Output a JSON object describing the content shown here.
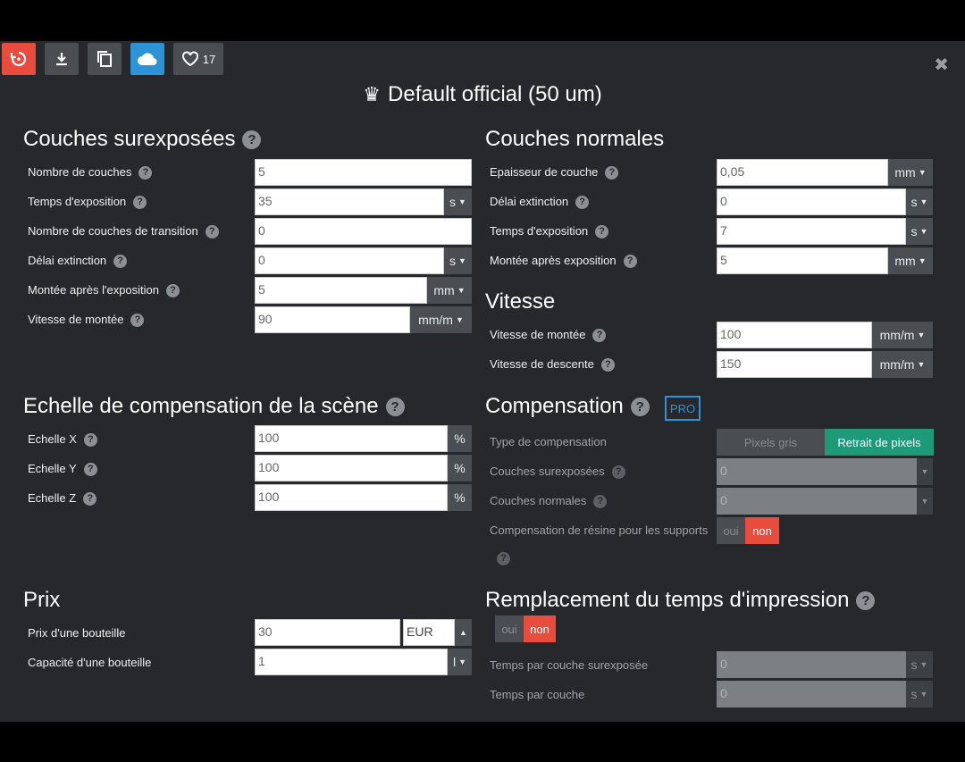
{
  "toolbar": {
    "likes": "17"
  },
  "title": "Default official (50 um)",
  "left": {
    "overexposed": {
      "heading": "Couches surexposées",
      "fields": [
        {
          "label": "Nombre de couches",
          "value": "5",
          "unit": ""
        },
        {
          "label": "Temps d'exposition",
          "value": "35",
          "unit": "s"
        },
        {
          "label": "Nombre de couches de transition",
          "value": "0",
          "unit": ""
        },
        {
          "label": "Délai extinction",
          "value": "0",
          "unit": "s"
        },
        {
          "label": "Montée après l'exposition",
          "value": "5",
          "unit": "mm"
        },
        {
          "label": "Vitesse de montée",
          "value": "90",
          "unit": "mm/m"
        }
      ]
    },
    "scale": {
      "heading": "Echelle de compensation de la scène",
      "fields": [
        {
          "label": "Echelle X",
          "value": "100",
          "unit": "%"
        },
        {
          "label": "Echelle Y",
          "value": "100",
          "unit": "%"
        },
        {
          "label": "Echelle Z",
          "value": "100",
          "unit": "%"
        }
      ]
    },
    "price": {
      "heading": "Prix",
      "bottle_price_label": "Prix d'une bouteille",
      "bottle_price_value": "30",
      "currency": "EUR",
      "capacity_label": "Capacité d'une bouteille",
      "capacity_value": "1",
      "capacity_unit": "l"
    }
  },
  "right": {
    "normal": {
      "heading": "Couches normales",
      "fields": [
        {
          "label": "Epaisseur de couche",
          "value": "0,05",
          "unit": "mm"
        },
        {
          "label": "Délai extinction",
          "value": "0",
          "unit": "s"
        },
        {
          "label": "Temps d'exposition",
          "value": "7",
          "unit": "s"
        },
        {
          "label": "Montée après exposition",
          "value": "5",
          "unit": "mm"
        }
      ]
    },
    "speed": {
      "heading": "Vitesse",
      "fields": [
        {
          "label": "Vitesse de montée",
          "value": "100",
          "unit": "mm/m"
        },
        {
          "label": "Vitesse de descente",
          "value": "150",
          "unit": "mm/m"
        }
      ]
    },
    "compensation": {
      "heading": "Compensation",
      "pro_badge": "PRO",
      "type_label": "Type de compensation",
      "type_options": [
        "Pixels gris",
        "Retrait de pixels"
      ],
      "overexposed_label": "Couches surexposées",
      "overexposed_value": "0",
      "normal_label": "Couches normales",
      "normal_value": "0",
      "resin_label": "Compensation de résine pour les supports",
      "yes": "oui",
      "no": "non"
    },
    "replace": {
      "heading": "Remplacement du temps d'impression",
      "yes": "oui",
      "no": "non",
      "per_overexposed_label": "Temps par couche surexposée",
      "per_overexposed_value": "0",
      "per_overexposed_unit": "s",
      "per_layer_label": "Temps par couche",
      "per_layer_value": "0",
      "per_layer_unit": "s"
    }
  },
  "colors": {
    "accent_red": "#e74c3c",
    "accent_blue": "#2b93d6",
    "accent_green": "#1e9a78",
    "panel": "#26282c"
  },
  "icons": [
    "undo-icon",
    "download-icon",
    "copy-icon",
    "cloud-icon",
    "heart-icon",
    "close-icon",
    "crown-icon",
    "help-icon",
    "caret-down-icon",
    "caret-up-icon"
  ]
}
